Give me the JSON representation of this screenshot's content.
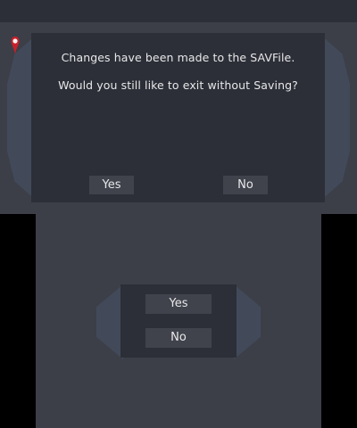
{
  "dialog": {
    "line1": "Changes have been made to the SAVFile.",
    "line2": "Would you still like to exit without Saving?",
    "yes_label": "Yes",
    "no_label": "No"
  },
  "touch_panel": {
    "yes_label": "Yes",
    "no_label": "No"
  },
  "icons": {
    "top_left": "map-pin-icon"
  },
  "colors": {
    "background": "#3c3f48",
    "dialog": "#2c2f37",
    "button": "#40434c",
    "accent": "#424a5a",
    "pin": "#c8202a"
  }
}
